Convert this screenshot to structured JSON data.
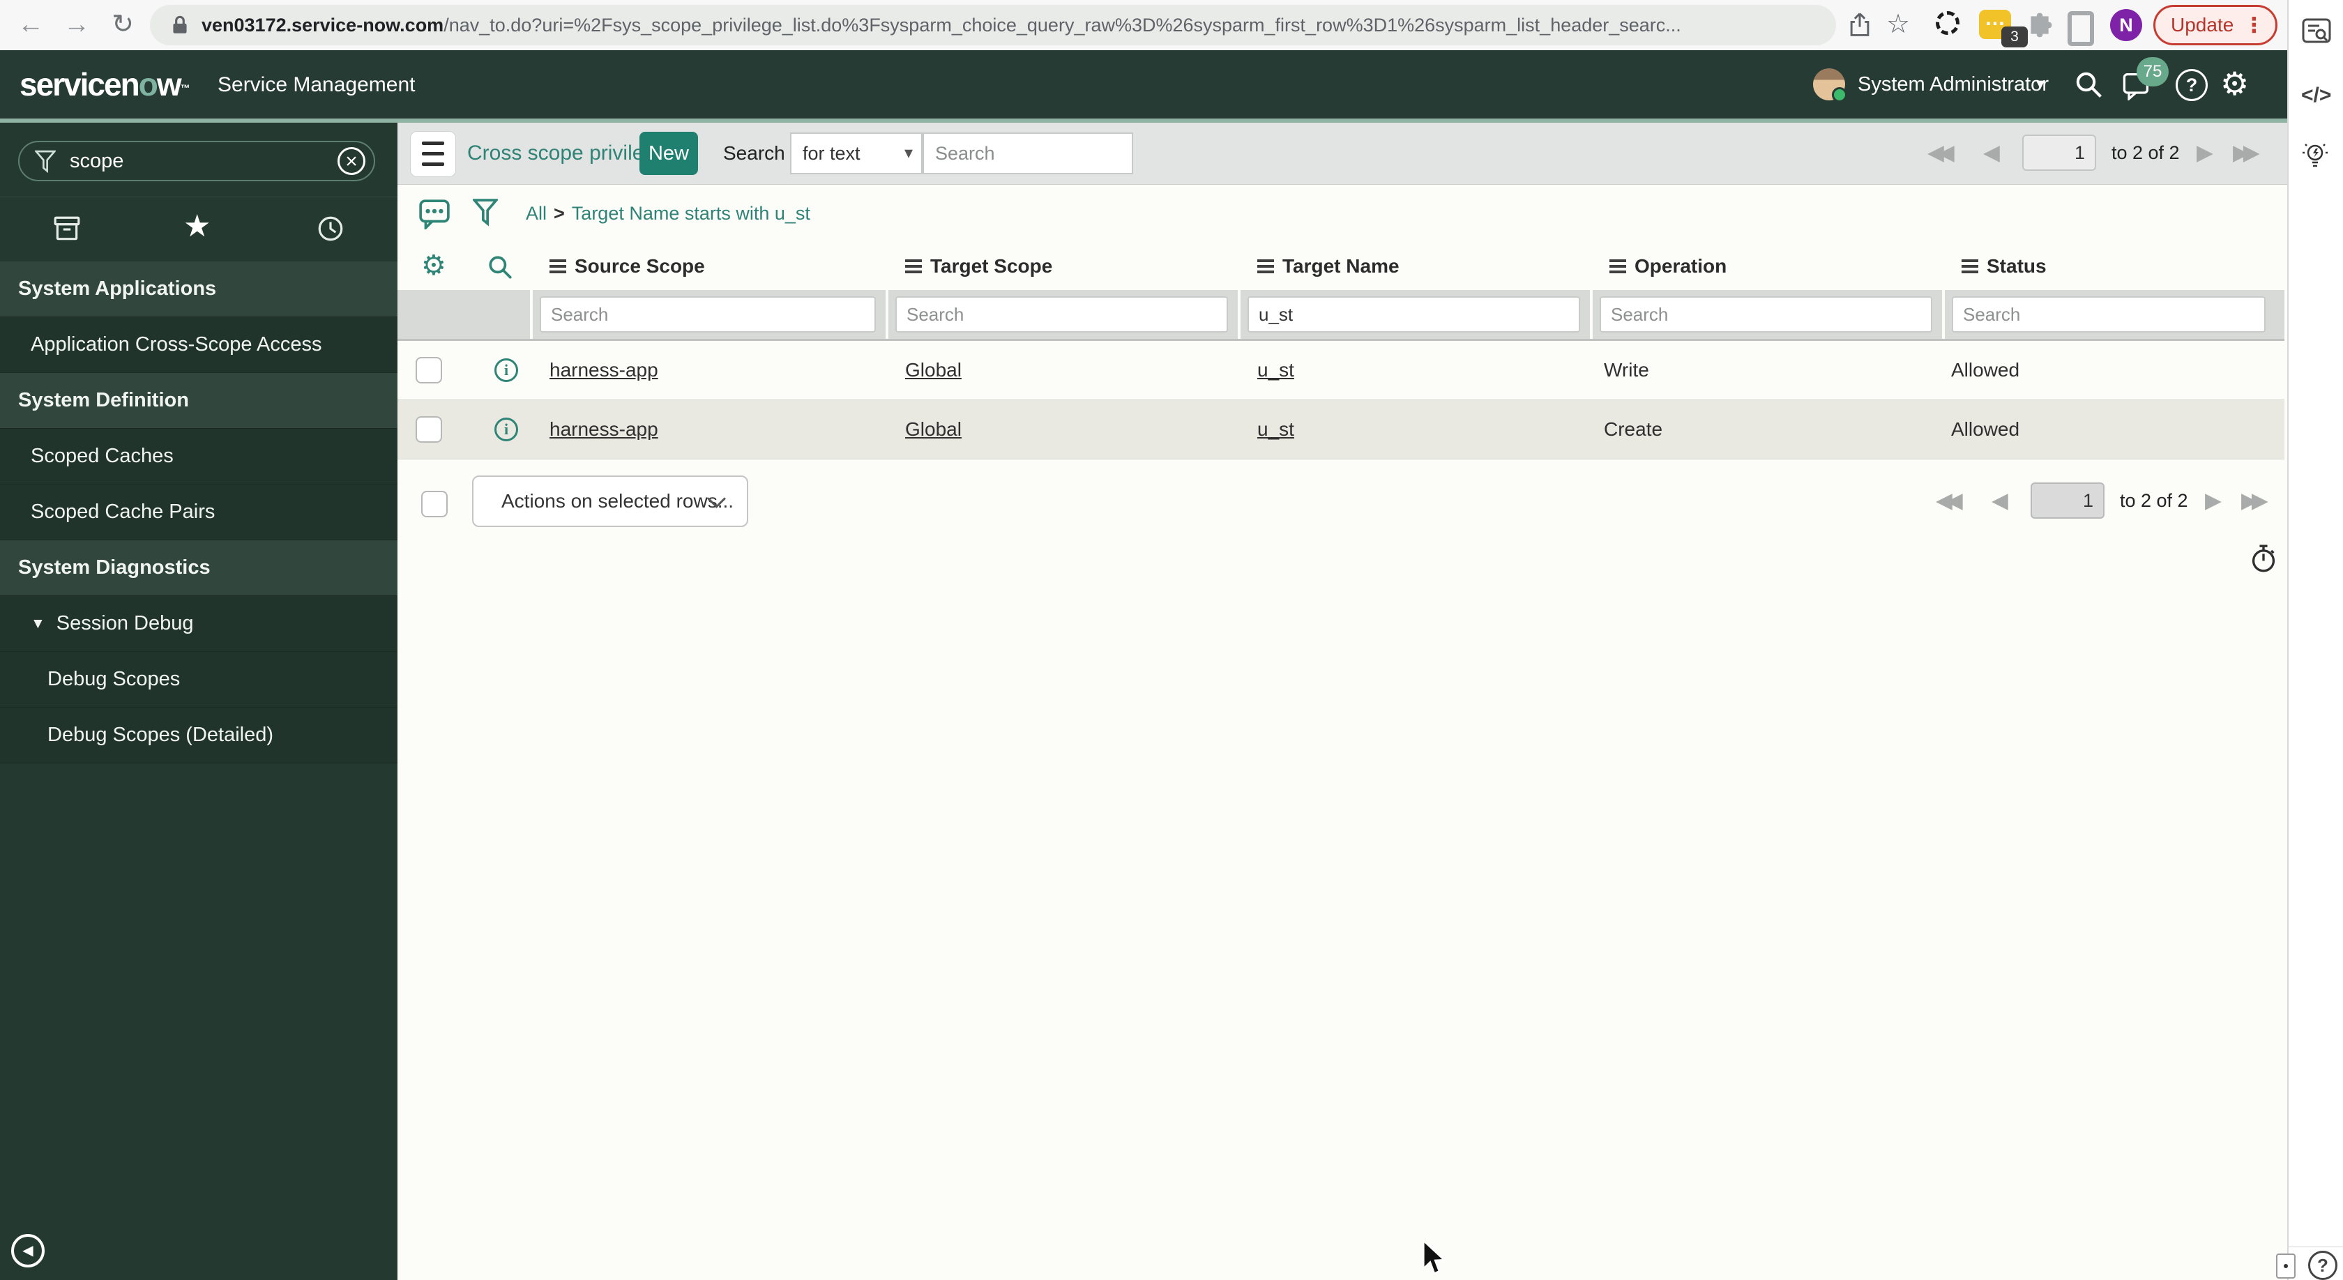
{
  "colors": {
    "accent_teal": "#1f8070",
    "link_teal": "#2f8376",
    "banner_bg": "#253b33",
    "sidebar_bg": "#243a31",
    "banner_stripe": "#8fb3a2",
    "notification_badge_green": "#68a88b",
    "update_red": "#c63c30",
    "avatar_purple": "#7e22a8",
    "extension_yellow": "#f2c229"
  },
  "icons": {
    "back": "←",
    "forward": "→",
    "reload": "↻",
    "bookmark": "☆",
    "overflow": "⋮",
    "ellipsis": "…",
    "first": "◀◀",
    "previous": "◀",
    "next": "▶",
    "last": "▶▶",
    "caret_down": "▾",
    "section_caret": "▼",
    "gear": "⚙",
    "star_filled": "★",
    "close": "×",
    "code_panel": "</>",
    "help": "?",
    "info": "i",
    "collapse": "◀",
    "chat_dots": "…",
    "tm": "™"
  },
  "browser": {
    "url_domain": "ven03172.service-now.com",
    "url_path": "/nav_to.do?uri=%2Fsys_scope_privilege_list.do%3Fsysparm_choice_query_raw%3D%26sysparm_first_row%3D1%26sysparm_list_header_searc...",
    "update_label": "Update",
    "profile_letter": "N",
    "extension_badge": "3"
  },
  "app_header": {
    "logo_pre": "servicen",
    "logo_o": "o",
    "logo_post": "w",
    "product_name": "Service Management",
    "user_name": "System Administrator",
    "notification_count": "75"
  },
  "sidebar": {
    "filter_value": "scope",
    "items": [
      {
        "label": "System Applications",
        "type": "section"
      },
      {
        "label": "Application Cross-Scope Access",
        "type": "item"
      },
      {
        "label": "System Definition",
        "type": "section"
      },
      {
        "label": "Scoped Caches",
        "type": "item"
      },
      {
        "label": "Scoped Cache Pairs",
        "type": "item"
      },
      {
        "label": "System Diagnostics",
        "type": "section"
      },
      {
        "label": "Session Debug",
        "type": "item-expanded"
      },
      {
        "label": "Debug Scopes",
        "type": "subitem"
      },
      {
        "label": "Debug Scopes (Detailed)",
        "type": "subitem"
      }
    ]
  },
  "list_header": {
    "title": "Cross scope privileges",
    "new_button": "New",
    "search_label": "Search",
    "search_type": "for text",
    "search_placeholder": "Search",
    "page_value": "1",
    "page_range": "to 2 of 2"
  },
  "breadcrumb": {
    "root": "All",
    "separator": ">",
    "filter": "Target Name starts with u_st"
  },
  "table": {
    "columns": [
      "Source Scope",
      "Target Scope",
      "Target Name",
      "Operation",
      "Status"
    ],
    "filter_placeholder": "Search",
    "filter_values": {
      "source_scope": "",
      "target_scope": "",
      "target_name": "u_st",
      "operation": "",
      "status": ""
    },
    "rows": [
      {
        "source_scope": "harness-app",
        "target_scope": "Global",
        "target_name": "u_st",
        "operation": "Write",
        "status": "Allowed"
      },
      {
        "source_scope": "harness-app",
        "target_scope": "Global",
        "target_name": "u_st",
        "operation": "Create",
        "status": "Allowed"
      }
    ]
  },
  "footer": {
    "actions_label": "Actions on selected rows...",
    "page_value": "1",
    "page_range": "to 2 of 2"
  }
}
